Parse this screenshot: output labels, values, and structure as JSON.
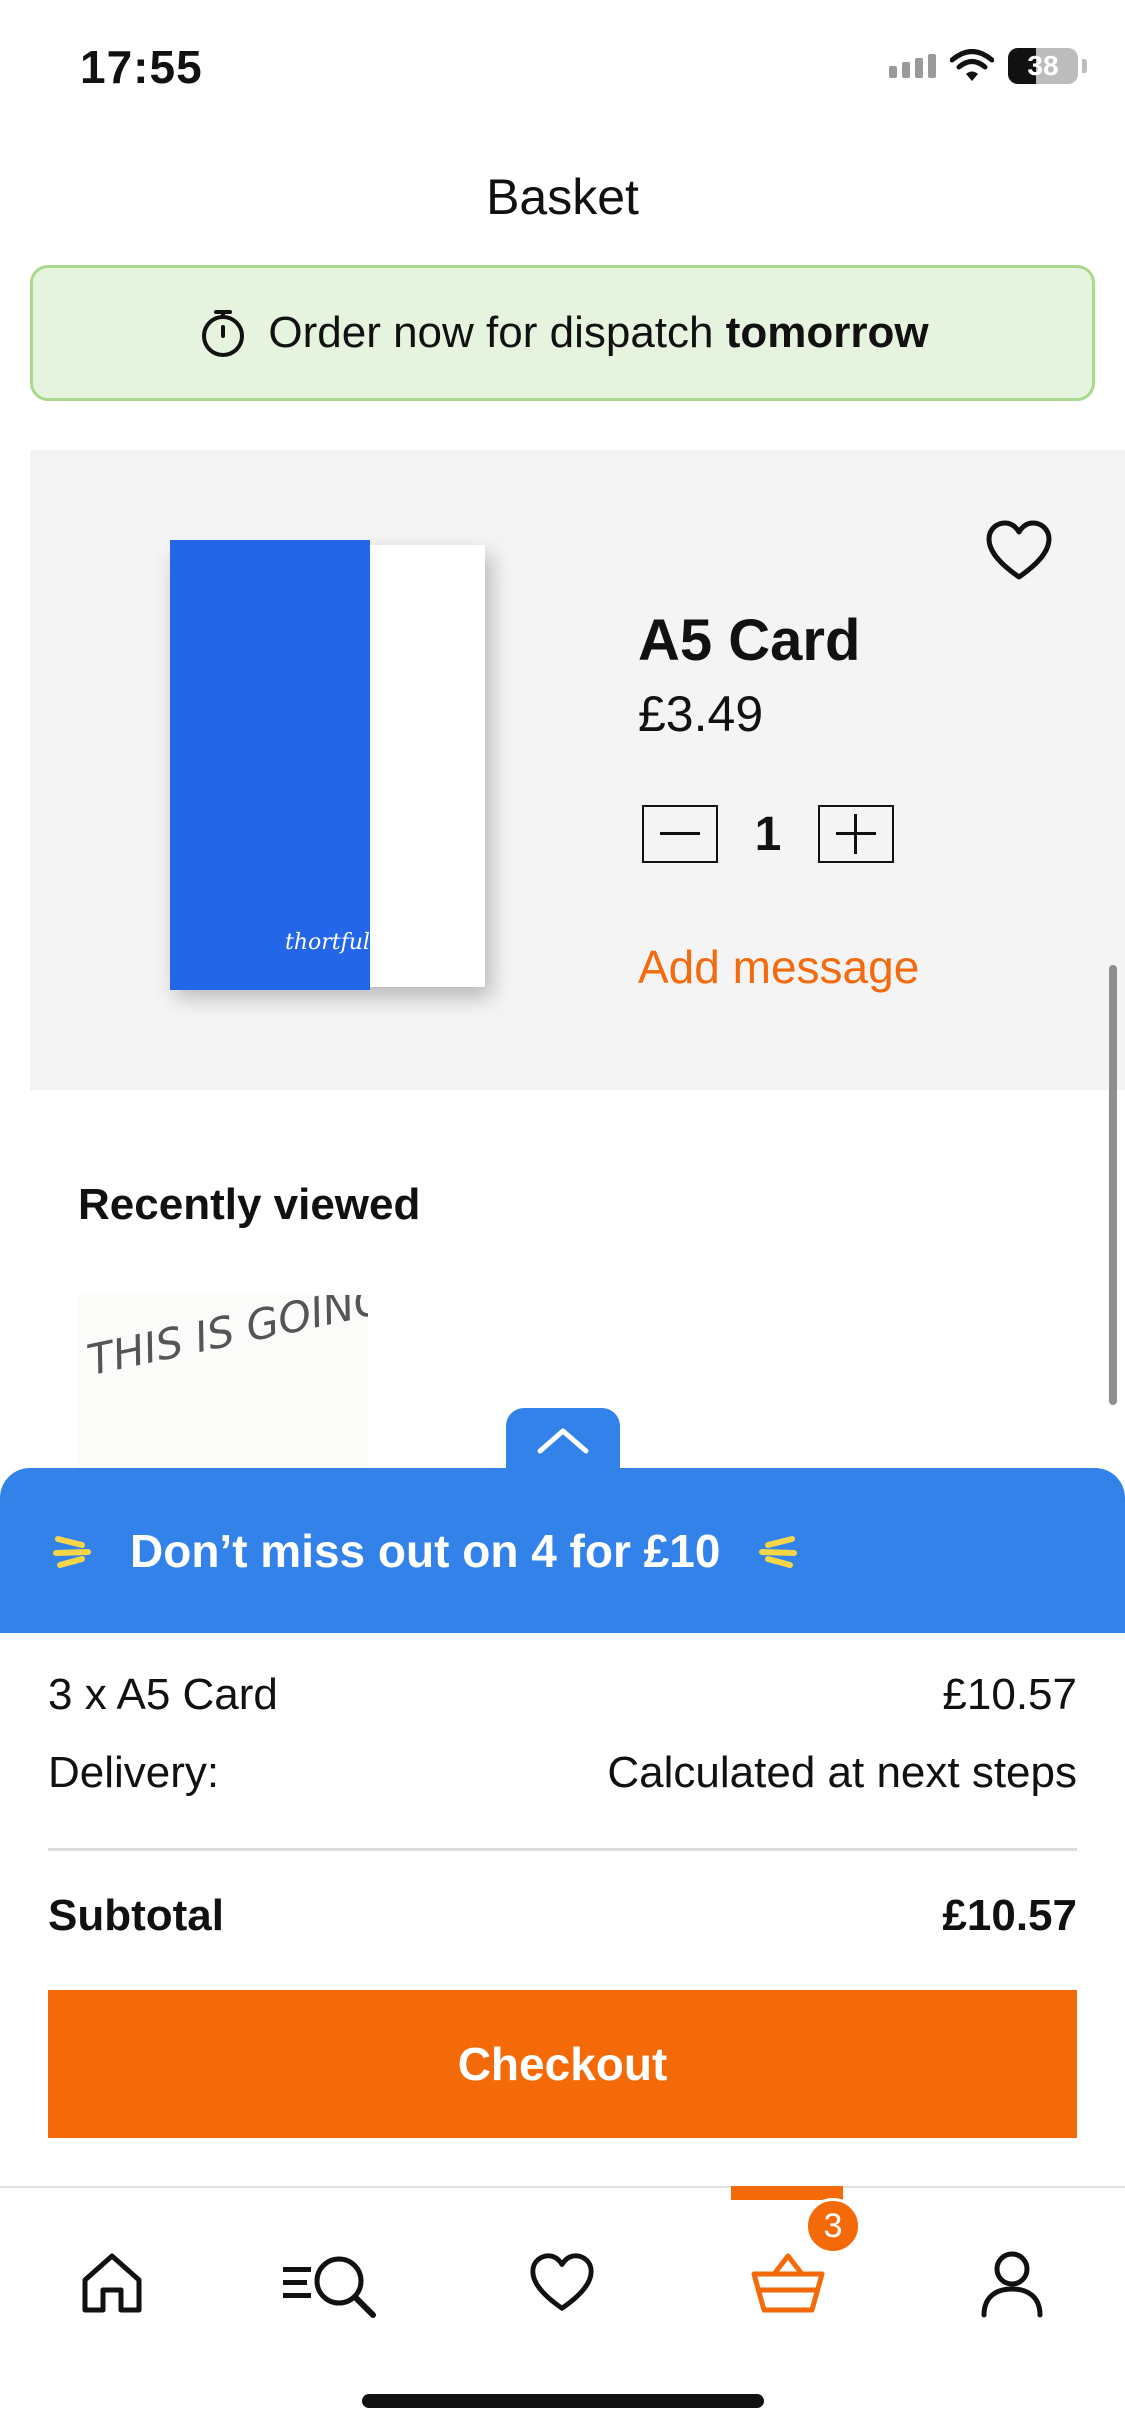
{
  "status_bar": {
    "time": "17:55",
    "battery": "38"
  },
  "header": {
    "title": "Basket"
  },
  "dispatch_banner": {
    "text": "Order now for dispatch",
    "emphasis": "tomorrow"
  },
  "basket_item": {
    "name": "A5 Card",
    "price": "£3.49",
    "quantity": "1",
    "add_message_label": "Add message",
    "card_front_color": "#2366e8",
    "card_logo": "thortful"
  },
  "recently_viewed": {
    "title": "Recently viewed",
    "thumb_text": "THIS IS GOING"
  },
  "promo": {
    "text": "Don’t miss out on 4 for £10"
  },
  "summary": {
    "items_label": "3 x A5 Card",
    "items_value": "£10.57",
    "delivery_label": "Delivery:",
    "delivery_value": "Calculated at next steps",
    "subtotal_label": "Subtotal",
    "subtotal_value": "£10.57"
  },
  "checkout": {
    "label": "Checkout"
  },
  "tab_bar": {
    "items": [
      "home-icon",
      "search-menu-icon",
      "heart-icon",
      "basket-icon",
      "account-icon"
    ],
    "active": "basket-icon",
    "basket_badge": "3"
  },
  "colors": {
    "accent": "#f56a08",
    "promo_blue": "#3382ea",
    "banner_green": "#e6f3df"
  }
}
